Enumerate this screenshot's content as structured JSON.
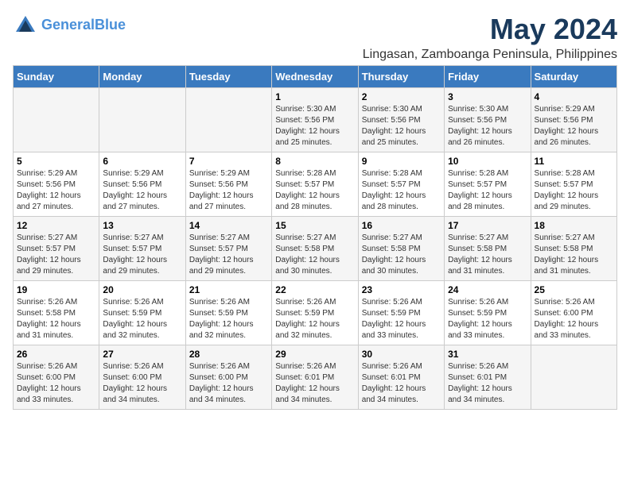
{
  "logo": {
    "line1": "General",
    "line2": "Blue"
  },
  "title": "May 2024",
  "subtitle": "Lingasan, Zamboanga Peninsula, Philippines",
  "headers": [
    "Sunday",
    "Monday",
    "Tuesday",
    "Wednesday",
    "Thursday",
    "Friday",
    "Saturday"
  ],
  "weeks": [
    [
      {
        "day": "",
        "sunrise": "",
        "sunset": "",
        "daylight": ""
      },
      {
        "day": "",
        "sunrise": "",
        "sunset": "",
        "daylight": ""
      },
      {
        "day": "",
        "sunrise": "",
        "sunset": "",
        "daylight": ""
      },
      {
        "day": "1",
        "sunrise": "Sunrise: 5:30 AM",
        "sunset": "Sunset: 5:56 PM",
        "daylight": "Daylight: 12 hours and 25 minutes."
      },
      {
        "day": "2",
        "sunrise": "Sunrise: 5:30 AM",
        "sunset": "Sunset: 5:56 PM",
        "daylight": "Daylight: 12 hours and 25 minutes."
      },
      {
        "day": "3",
        "sunrise": "Sunrise: 5:30 AM",
        "sunset": "Sunset: 5:56 PM",
        "daylight": "Daylight: 12 hours and 26 minutes."
      },
      {
        "day": "4",
        "sunrise": "Sunrise: 5:29 AM",
        "sunset": "Sunset: 5:56 PM",
        "daylight": "Daylight: 12 hours and 26 minutes."
      }
    ],
    [
      {
        "day": "5",
        "sunrise": "Sunrise: 5:29 AM",
        "sunset": "Sunset: 5:56 PM",
        "daylight": "Daylight: 12 hours and 27 minutes."
      },
      {
        "day": "6",
        "sunrise": "Sunrise: 5:29 AM",
        "sunset": "Sunset: 5:56 PM",
        "daylight": "Daylight: 12 hours and 27 minutes."
      },
      {
        "day": "7",
        "sunrise": "Sunrise: 5:29 AM",
        "sunset": "Sunset: 5:56 PM",
        "daylight": "Daylight: 12 hours and 27 minutes."
      },
      {
        "day": "8",
        "sunrise": "Sunrise: 5:28 AM",
        "sunset": "Sunset: 5:57 PM",
        "daylight": "Daylight: 12 hours and 28 minutes."
      },
      {
        "day": "9",
        "sunrise": "Sunrise: 5:28 AM",
        "sunset": "Sunset: 5:57 PM",
        "daylight": "Daylight: 12 hours and 28 minutes."
      },
      {
        "day": "10",
        "sunrise": "Sunrise: 5:28 AM",
        "sunset": "Sunset: 5:57 PM",
        "daylight": "Daylight: 12 hours and 28 minutes."
      },
      {
        "day": "11",
        "sunrise": "Sunrise: 5:28 AM",
        "sunset": "Sunset: 5:57 PM",
        "daylight": "Daylight: 12 hours and 29 minutes."
      }
    ],
    [
      {
        "day": "12",
        "sunrise": "Sunrise: 5:27 AM",
        "sunset": "Sunset: 5:57 PM",
        "daylight": "Daylight: 12 hours and 29 minutes."
      },
      {
        "day": "13",
        "sunrise": "Sunrise: 5:27 AM",
        "sunset": "Sunset: 5:57 PM",
        "daylight": "Daylight: 12 hours and 29 minutes."
      },
      {
        "day": "14",
        "sunrise": "Sunrise: 5:27 AM",
        "sunset": "Sunset: 5:57 PM",
        "daylight": "Daylight: 12 hours and 29 minutes."
      },
      {
        "day": "15",
        "sunrise": "Sunrise: 5:27 AM",
        "sunset": "Sunset: 5:58 PM",
        "daylight": "Daylight: 12 hours and 30 minutes."
      },
      {
        "day": "16",
        "sunrise": "Sunrise: 5:27 AM",
        "sunset": "Sunset: 5:58 PM",
        "daylight": "Daylight: 12 hours and 30 minutes."
      },
      {
        "day": "17",
        "sunrise": "Sunrise: 5:27 AM",
        "sunset": "Sunset: 5:58 PM",
        "daylight": "Daylight: 12 hours and 31 minutes."
      },
      {
        "day": "18",
        "sunrise": "Sunrise: 5:27 AM",
        "sunset": "Sunset: 5:58 PM",
        "daylight": "Daylight: 12 hours and 31 minutes."
      }
    ],
    [
      {
        "day": "19",
        "sunrise": "Sunrise: 5:26 AM",
        "sunset": "Sunset: 5:58 PM",
        "daylight": "Daylight: 12 hours and 31 minutes."
      },
      {
        "day": "20",
        "sunrise": "Sunrise: 5:26 AM",
        "sunset": "Sunset: 5:59 PM",
        "daylight": "Daylight: 12 hours and 32 minutes."
      },
      {
        "day": "21",
        "sunrise": "Sunrise: 5:26 AM",
        "sunset": "Sunset: 5:59 PM",
        "daylight": "Daylight: 12 hours and 32 minutes."
      },
      {
        "day": "22",
        "sunrise": "Sunrise: 5:26 AM",
        "sunset": "Sunset: 5:59 PM",
        "daylight": "Daylight: 12 hours and 32 minutes."
      },
      {
        "day": "23",
        "sunrise": "Sunrise: 5:26 AM",
        "sunset": "Sunset: 5:59 PM",
        "daylight": "Daylight: 12 hours and 33 minutes."
      },
      {
        "day": "24",
        "sunrise": "Sunrise: 5:26 AM",
        "sunset": "Sunset: 5:59 PM",
        "daylight": "Daylight: 12 hours and 33 minutes."
      },
      {
        "day": "25",
        "sunrise": "Sunrise: 5:26 AM",
        "sunset": "Sunset: 6:00 PM",
        "daylight": "Daylight: 12 hours and 33 minutes."
      }
    ],
    [
      {
        "day": "26",
        "sunrise": "Sunrise: 5:26 AM",
        "sunset": "Sunset: 6:00 PM",
        "daylight": "Daylight: 12 hours and 33 minutes."
      },
      {
        "day": "27",
        "sunrise": "Sunrise: 5:26 AM",
        "sunset": "Sunset: 6:00 PM",
        "daylight": "Daylight: 12 hours and 34 minutes."
      },
      {
        "day": "28",
        "sunrise": "Sunrise: 5:26 AM",
        "sunset": "Sunset: 6:00 PM",
        "daylight": "Daylight: 12 hours and 34 minutes."
      },
      {
        "day": "29",
        "sunrise": "Sunrise: 5:26 AM",
        "sunset": "Sunset: 6:01 PM",
        "daylight": "Daylight: 12 hours and 34 minutes."
      },
      {
        "day": "30",
        "sunrise": "Sunrise: 5:26 AM",
        "sunset": "Sunset: 6:01 PM",
        "daylight": "Daylight: 12 hours and 34 minutes."
      },
      {
        "day": "31",
        "sunrise": "Sunrise: 5:26 AM",
        "sunset": "Sunset: 6:01 PM",
        "daylight": "Daylight: 12 hours and 34 minutes."
      },
      {
        "day": "",
        "sunrise": "",
        "sunset": "",
        "daylight": ""
      }
    ]
  ]
}
